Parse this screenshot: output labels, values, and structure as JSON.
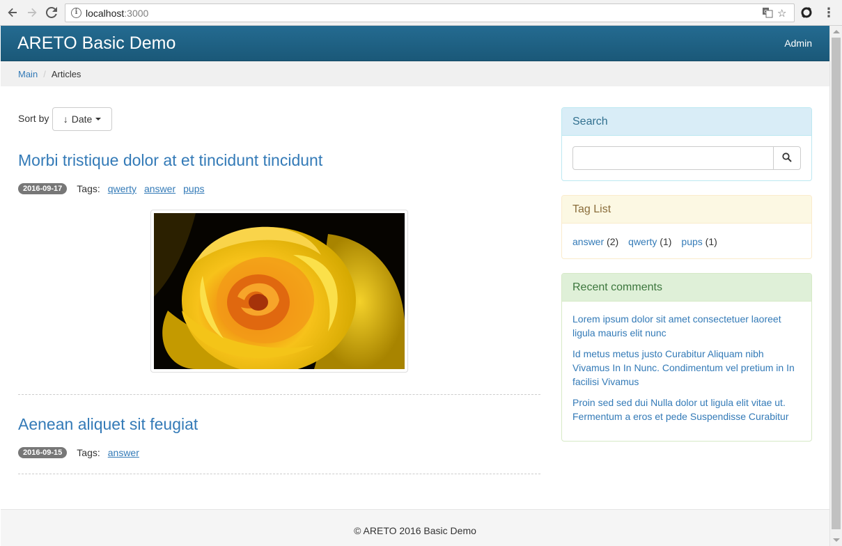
{
  "browser": {
    "url_host": "localhost",
    "url_port": ":3000",
    "icons": {
      "back": "back-arrow-icon",
      "forward": "forward-arrow-icon",
      "reload": "reload-icon",
      "info": "info-icon",
      "translate": "translate-icon",
      "bookmark": "star-icon",
      "extension": "sync-extension-icon",
      "menu": "kebab-menu-icon"
    }
  },
  "navbar": {
    "brand": "ARETO Basic Demo",
    "admin_link": "Admin",
    "color": "#1f6386"
  },
  "breadcrumb": {
    "items": [
      "Main",
      "Articles"
    ]
  },
  "sort": {
    "label": "Sort by",
    "button_label": "Date",
    "arrow": "↓"
  },
  "articles": [
    {
      "title": "Morbi tristique dolor at et tincidunt tincidunt",
      "date": "2016-09-17",
      "tags_label": "Tags:",
      "tags": [
        "qwerty",
        "answer",
        "pups"
      ],
      "image": "yellow-rose-photo"
    },
    {
      "title": "Aenean aliquet sit feugiat",
      "date": "2016-09-15",
      "tags_label": "Tags:",
      "tags": [
        "answer"
      ]
    }
  ],
  "sidebar": {
    "search": {
      "heading": "Search",
      "placeholder": "",
      "value": ""
    },
    "tag_list": {
      "heading": "Tag List",
      "items": [
        {
          "name": "answer",
          "count": "(2)"
        },
        {
          "name": "qwerty",
          "count": "(1)"
        },
        {
          "name": "pups",
          "count": "(1)"
        }
      ]
    },
    "recent_comments": {
      "heading": "Recent comments",
      "items": [
        "Lorem ipsum dolor sit amet consectetuer laoreet ligula mauris elit nunc",
        "Id metus metus justo Curabitur Aliquam nibh Vivamus In In Nunc. Condimentum vel pretium in In facilisi Vivamus",
        "Proin sed sed dui Nulla dolor ut ligula elit vitae ut. Fermentum a eros et pede Suspendisse Curabitur"
      ]
    }
  },
  "footer": {
    "text": "© ARETO 2016 Basic Demo"
  },
  "colors": {
    "link": "#337ab7",
    "badge": "#777777",
    "info_panel": "#d9edf7",
    "warning_panel": "#fcf8e3",
    "success_panel": "#dff0d8"
  }
}
